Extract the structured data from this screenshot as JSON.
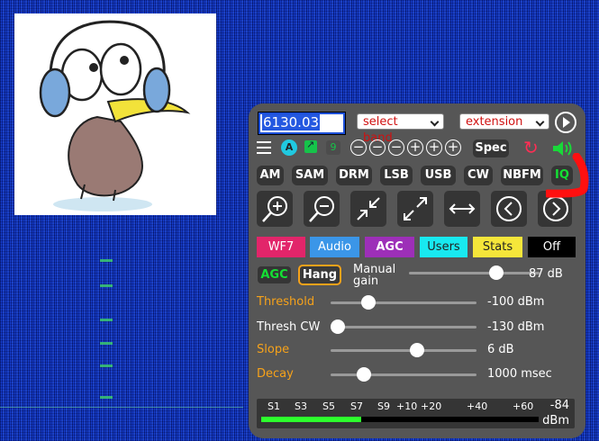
{
  "frequency": {
    "value": "6130.03"
  },
  "band_select": {
    "selected": "select band"
  },
  "extension_select": {
    "selected": "extension"
  },
  "toolbar": {
    "badge_a": "A",
    "badge_9": "9",
    "spec_label": "Spec"
  },
  "modes": [
    "AM",
    "SAM",
    "DRM",
    "LSB",
    "USB",
    "CW",
    "NBFM",
    "IQ"
  ],
  "tabs": [
    {
      "label": "WF7",
      "bg": "#e2256a",
      "fg": "#ffffff"
    },
    {
      "label": "Audio",
      "bg": "#3b96e8",
      "fg": "#ffffff"
    },
    {
      "label": "AGC",
      "bg": "#9d2fb8",
      "fg": "#ffffff"
    },
    {
      "label": "Users",
      "bg": "#18e9f0",
      "fg": "#222222"
    },
    {
      "label": "Stats",
      "bg": "#f5e63a",
      "fg": "#222222"
    },
    {
      "label": "Off",
      "bg": "#000000",
      "fg": "#ffffff"
    }
  ],
  "agc": {
    "agc_label": "AGC",
    "hang_label": "Hang",
    "manual_gain_label": "Manual gain",
    "manual_gain_value": "87 dB",
    "manual_gain_level": 0.67,
    "threshold_label": "Threshold",
    "threshold_value": "-100 dBm",
    "threshold_level": 0.26,
    "thresh_cw_label": "Thresh CW",
    "thresh_cw_value": "-130 dBm",
    "thresh_cw_level": 0.05,
    "slope_label": "Slope",
    "slope_value": "6 dB",
    "slope_level": 0.59,
    "decay_label": "Decay",
    "decay_value": "1000 msec",
    "decay_level": 0.23
  },
  "smeter": {
    "ticks": [
      "S1",
      "S3",
      "S5",
      "S7",
      "S9",
      "+10",
      "+20",
      "+40",
      "+60"
    ],
    "value": "-84",
    "unit": "dBm",
    "level": 0.36
  },
  "colors": {
    "panel_bg": "#565656",
    "button_bg": "#353535",
    "accent_orange": "#f6a21a",
    "accent_green": "#14e034",
    "reload_red": "#ff2e54"
  }
}
